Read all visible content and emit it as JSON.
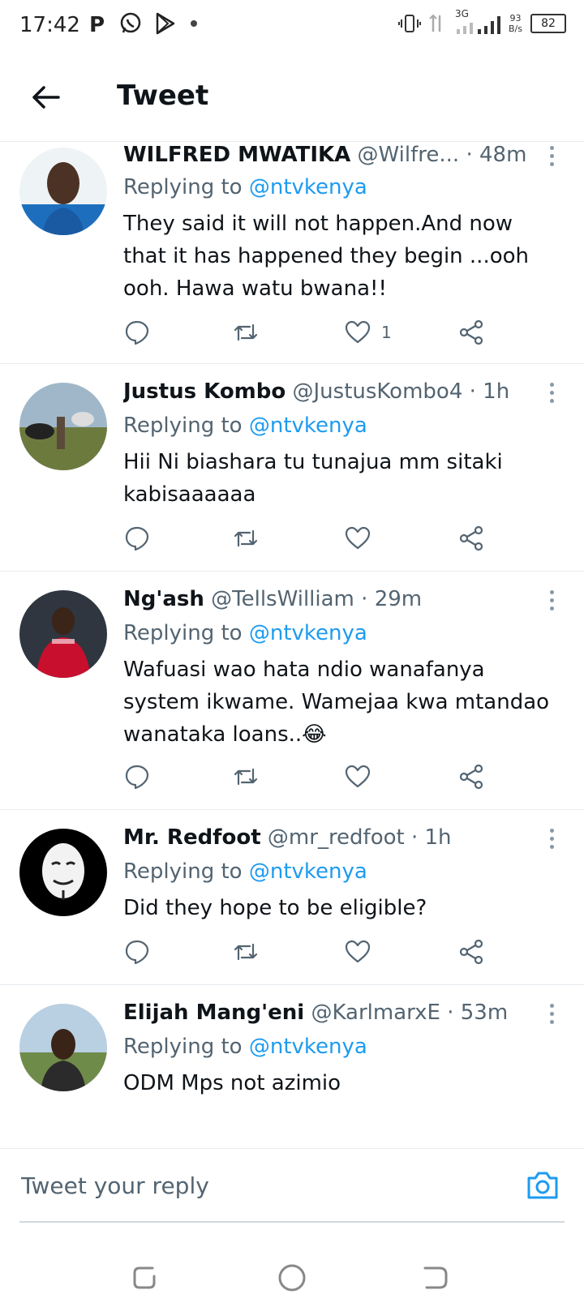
{
  "status_bar": {
    "time": "17:42",
    "net_speed_value": "93",
    "net_speed_unit": "B/s",
    "network_type": "3G",
    "battery": "82",
    "left_icons": [
      "parking-icon",
      "whatsapp-icon",
      "play-store-icon",
      "dot-icon"
    ],
    "right_icons": [
      "vibrate-icon",
      "data-arrows-icon",
      "signal-icon",
      "signal-icon-2",
      "battery-icon"
    ]
  },
  "header": {
    "title": "Tweet"
  },
  "colors": {
    "accent": "#1d9bf0",
    "muted": "#536471",
    "text": "#0f1419",
    "divider": "#e6ecf0"
  },
  "tweets": [
    {
      "name": "WILFRED MWATIKA",
      "handle": "@Wilfre...",
      "time": "48m",
      "replying_prefix": "Replying to",
      "replying_to": "@ntvkenya",
      "text": "They said it will not happen.And now that it has happened they begin ...ooh ooh. Hawa watu bwana!!",
      "like_count": "1"
    },
    {
      "name": "Justus Kombo",
      "handle": "@JustusKombo4",
      "time": "1h",
      "replying_prefix": "Replying to",
      "replying_to": "@ntvkenya",
      "text": "Hii Ni biashara tu tunajua mm sitaki kabisaaaaaa",
      "like_count": ""
    },
    {
      "name": "Ng'ash",
      "handle": "@TellsWilliam",
      "time": "29m",
      "replying_prefix": "Replying to",
      "replying_to": "@ntvkenya",
      "text": "Wafuasi wao hata ndio wanafanya system ikwame. Wamejaa kwa mtandao wanataka loans..😂",
      "like_count": ""
    },
    {
      "name": "Mr. Redfoot",
      "handle": "@mr_redfoot",
      "time": "1h",
      "replying_prefix": "Replying to",
      "replying_to": "@ntvkenya",
      "text": "Did they hope to be eligible?",
      "like_count": ""
    },
    {
      "name": "Elijah Mang'eni",
      "handle": "@KarlmarxE",
      "time": "53m",
      "replying_prefix": "Replying to",
      "replying_to": "@ntvkenya",
      "text": "ODM Mps not azimio",
      "like_count": ""
    }
  ],
  "reply_bar": {
    "placeholder": "Tweet your reply"
  },
  "nav_bar": {
    "icons": [
      "recents-icon",
      "home-circle-icon",
      "back-nav-icon"
    ]
  }
}
